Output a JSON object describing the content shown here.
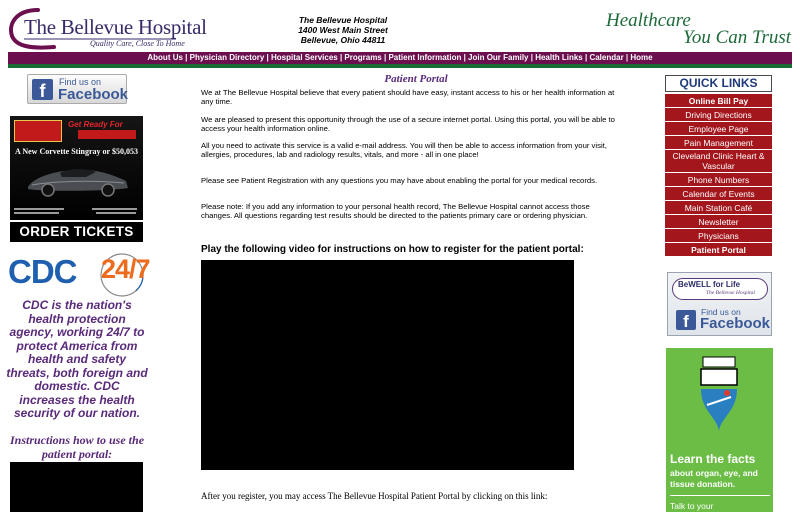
{
  "header": {
    "logo_name": "The Bellevue Hospital",
    "logo_tagline": "Quality Care, Close To Home",
    "address_lines": [
      "The Bellevue Hospital",
      "1400 West Main Street",
      "Bellevue, Ohio 44811"
    ],
    "slogan_line1": "Healthcare",
    "slogan_line2": "You Can Trust"
  },
  "nav": {
    "items": [
      "About Us",
      "Physician Directory",
      "Hospital Services",
      "Programs",
      "Patient Information",
      "Join Our Family",
      "Health Links",
      "Calendar",
      "Home"
    ]
  },
  "left": {
    "facebook": {
      "find_us": "Find us on",
      "brand": "Facebook",
      "glyph": "f"
    },
    "raffle": {
      "ready_text": "Get Ready For",
      "headline": "A New Corvette Stingray or $50,053"
    },
    "order_button": "ORDER TICKETS",
    "cdc": {
      "logo_text": "CDC",
      "logo_247": "24/7",
      "description": "CDC is the nation's health protection agency, working 24/7 to protect America from health and safety threats, both foreign and domestic. CDC increases the health security of our nation."
    },
    "instructions_title": "Instructions how to use the patient portal:"
  },
  "main": {
    "title": "Patient Portal",
    "paragraphs": [
      "We at The Bellevue Hospital believe that every patient should have easy, instant access to his or her health information at any time.",
      "We are pleased to present this opportunity through the use of a secure internet portal. Using this portal, you will be able to access your health information online.",
      "All you need to activate this service is a valid e-mail address. You will then be able to access information from your visit, allergies, procedures, lab and radiology results, vitals, and more - all in one place!",
      "Please see Patient Registration with any questions you may have about enabling the portal for your medical records.",
      "Please note: If you add any information to your personal health record, The Bellevue Hospital cannot access those changes. All questions regarding test results should be directed to the patients primary care or ordering physician."
    ],
    "video_title": "Play the following video for instructions on how to register for the patient portal:",
    "after_text": "After you register, you may access The Bellevue Hospital Patient Portal by clicking on this link:"
  },
  "right": {
    "quick_links_title": "QUICK LINKS",
    "quick_links": [
      "Online Bill Pay",
      "Driving Directions",
      "Employee Page",
      "Pain Management",
      "Cleveland Clinic Heart & Vascular",
      "Phone Numbers",
      "Calendar of Events",
      "Main Station Café",
      "Newsletter",
      "Physicians",
      "Patient Portal"
    ],
    "bowell": {
      "title": "BeWELL for Life",
      "subtitle": "The Bellevue Hospital",
      "find_us": "Find us on",
      "brand": "Facebook",
      "glyph": "f"
    },
    "donate": {
      "facts_title": "Learn the facts",
      "facts_sub": "about organ, eye, and tissue donation.",
      "talk": "Talk to your"
    }
  },
  "colors": {
    "nav_bg": "#6b0f4f",
    "nav_underline": "#1a6b34",
    "quick_link_bg": "#a3161c",
    "slogan": "#1e6a3a",
    "facebook": "#3b5998",
    "donate_bg": "#6bbd45"
  }
}
